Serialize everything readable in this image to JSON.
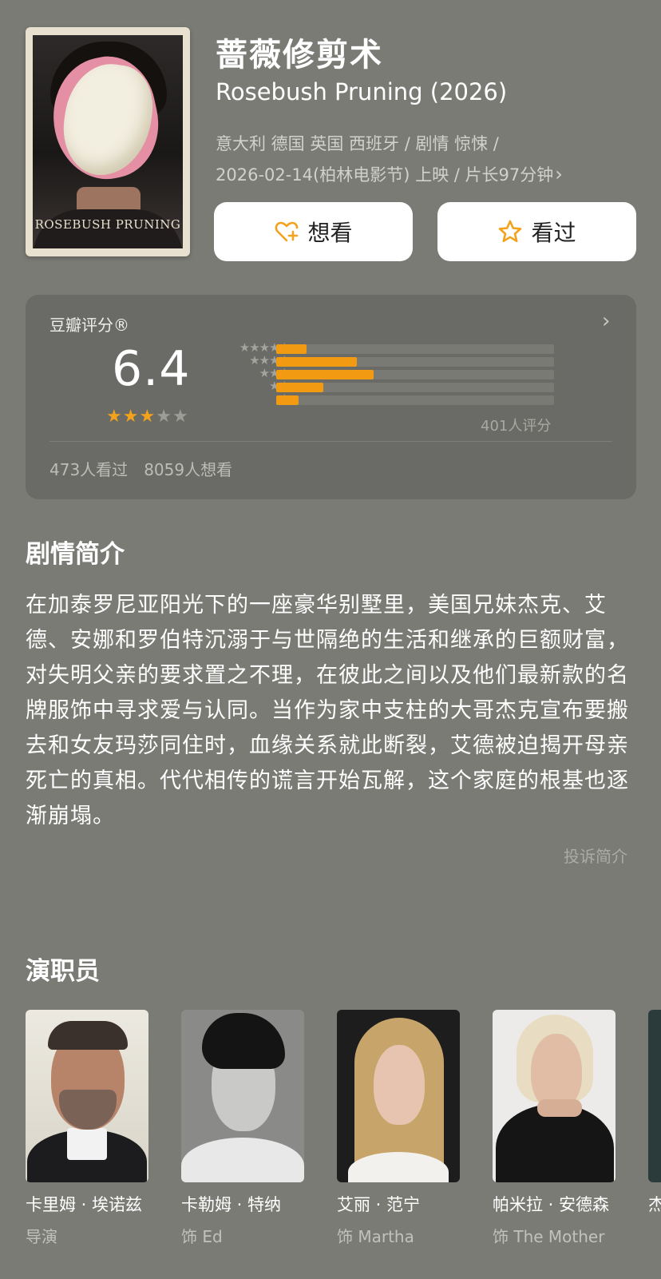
{
  "movie": {
    "title": "蔷薇修剪术",
    "original_title": "Rosebush Pruning (2026)",
    "meta_line1": "意大利 德国 英国 西班牙 / 剧情 惊悚 /",
    "meta_line2": "2026-02-14(柏林电影节) 上映 / 片长97分钟",
    "poster_text": "ROSEBUSH PRUNING"
  },
  "actions": {
    "wish_label": "想看",
    "seen_label": "看过"
  },
  "rating": {
    "label": "豆瓣评分®",
    "score": "6.4",
    "stars_filled": 3,
    "stars_total": 5,
    "distribution": [
      {
        "stars": 5,
        "fraction": 0.11
      },
      {
        "stars": 4,
        "fraction": 0.29
      },
      {
        "stars": 3,
        "fraction": 0.35
      },
      {
        "stars": 2,
        "fraction": 0.17
      },
      {
        "stars": 1,
        "fraction": 0.08
      }
    ],
    "count_text": "401人评分",
    "watched_text": "473人看过",
    "want_text": "8059人想看"
  },
  "synopsis": {
    "heading": "剧情简介",
    "text": "在加泰罗尼亚阳光下的一座豪华别墅里，美国兄妹杰克、艾德、安娜和罗伯特沉溺于与世隔绝的生活和继承的巨额财富，对失明父亲的要求置之不理，在彼此之间以及他们最新款的名牌服饰中寻求爱与认同。当作为家中支柱的大哥杰克宣布要搬去和女友玛莎同住时，血缘关系就此断裂，艾德被迫揭开母亲死亡的真相。代代相传的谎言开始瓦解，这个家庭的根基也逐渐崩塌。",
    "complain_label": "投诉简介"
  },
  "cast": {
    "heading": "演职员",
    "members": [
      {
        "name": "卡里姆 · 埃诺兹",
        "role": "导演"
      },
      {
        "name": "卡勒姆 · 特纳",
        "role": "饰 Ed"
      },
      {
        "name": "艾丽 · 范宁",
        "role": "饰 Martha"
      },
      {
        "name": "帕米拉 · 安德森",
        "role": "饰 The Mother"
      }
    ],
    "partial_name": "杰"
  },
  "colors": {
    "background": "#7b7b76",
    "card": "#6a6a66",
    "accent_star": "#f3a21b",
    "bar": "#f29a12"
  }
}
